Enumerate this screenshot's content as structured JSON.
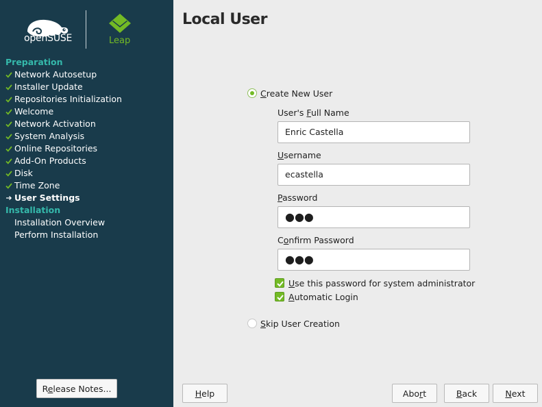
{
  "branding": {
    "brand_main": "openSUSE",
    "leap_label": "Leap"
  },
  "sidebar": {
    "sections": [
      {
        "title": "Preparation",
        "items": [
          {
            "label": "Network Autosetup",
            "state": "done"
          },
          {
            "label": "Installer Update",
            "state": "done"
          },
          {
            "label": "Repositories Initialization",
            "state": "done"
          },
          {
            "label": "Welcome",
            "state": "done"
          },
          {
            "label": "Network Activation",
            "state": "done"
          },
          {
            "label": "System Analysis",
            "state": "done"
          },
          {
            "label": "Online Repositories",
            "state": "done"
          },
          {
            "label": "Add-On Products",
            "state": "done"
          },
          {
            "label": "Disk",
            "state": "done"
          },
          {
            "label": "Time Zone",
            "state": "done"
          },
          {
            "label": "User Settings",
            "state": "current"
          }
        ]
      },
      {
        "title": "Installation",
        "items": [
          {
            "label": "Installation Overview",
            "state": "pending"
          },
          {
            "label": "Perform Installation",
            "state": "pending"
          }
        ]
      }
    ],
    "release_notes_label": "Release Notes..."
  },
  "main": {
    "title": "Local User",
    "create_user": {
      "label": "Create New User",
      "selected": true,
      "full_name_label": "User's Full Name",
      "full_name_value": "Enric Castella",
      "username_label": "Username",
      "username_value": "ecastella",
      "password_label": "Password",
      "password_value": "●●●",
      "confirm_label": "Confirm Password",
      "confirm_value": "●●●",
      "use_for_admin_label": "Use this password for system administrator",
      "use_for_admin_checked": true,
      "auto_login_label": "Automatic Login",
      "auto_login_checked": true
    },
    "skip_user": {
      "label": "Skip User Creation",
      "selected": false
    }
  },
  "footer": {
    "help": "Help",
    "abort": "Abort",
    "back": "Back",
    "next": "Next"
  },
  "colors": {
    "sidebar_bg": "#193b4b",
    "section_title": "#35b9ab",
    "accent_green": "#73ba25",
    "main_bg": "#ececec"
  }
}
